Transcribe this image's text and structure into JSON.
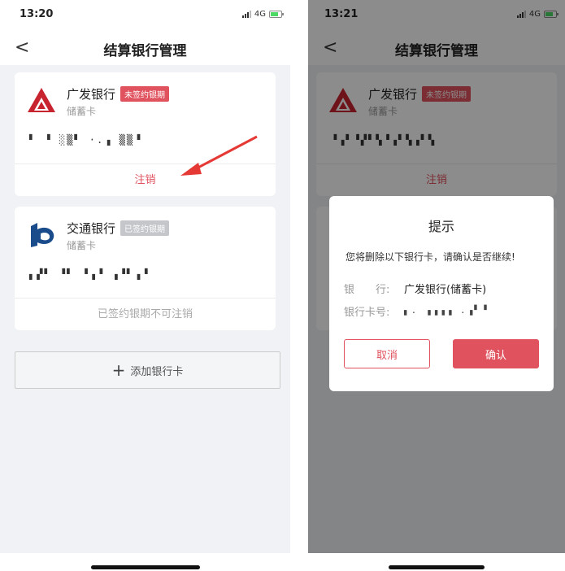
{
  "left": {
    "status": {
      "time": "13:20",
      "network": "4G"
    },
    "nav": {
      "back": "<",
      "title": "结算银行管理"
    },
    "cards": [
      {
        "bank": "广发银行",
        "tag": "未签约银期",
        "type": "储蓄卡",
        "number": "▘ ▝ ░▒▘ ·.▗ ▒▒▝",
        "action": "注销"
      },
      {
        "bank": "交通银行",
        "tag": "已签约银期",
        "type": "储蓄卡",
        "number": "▖▞▘ ▝▘ ▝▗▝ ▗▝▘▗▝",
        "action": "已签约银期不可注销"
      }
    ],
    "add_card": {
      "plus": "+",
      "label": "添加银行卡"
    }
  },
  "right": {
    "status": {
      "time": "13:21",
      "network": "4G"
    },
    "nav": {
      "back": "<",
      "title": "结算银行管理"
    },
    "card": {
      "bank": "广发银行",
      "tag": "未签约银期",
      "type": "储蓄卡",
      "number": "▝▗▘▝▞▘▚▝▗▘▚▗▘▚",
      "action": "注销"
    },
    "dialog": {
      "title": "提示",
      "message": "您将删除以下银行卡，请确认是否继续!",
      "bank_label": "银　　行:",
      "bank_value": "广发银行(储蓄卡)",
      "card_label": "银行卡号:",
      "card_value": "▖. ▗▗▗▗ .▗▘▝",
      "cancel": "取消",
      "confirm": "确认"
    }
  },
  "colors": {
    "accent": "#e0525e",
    "bg": "#f0f2f5",
    "gray_tag": "#c4c6ca"
  }
}
